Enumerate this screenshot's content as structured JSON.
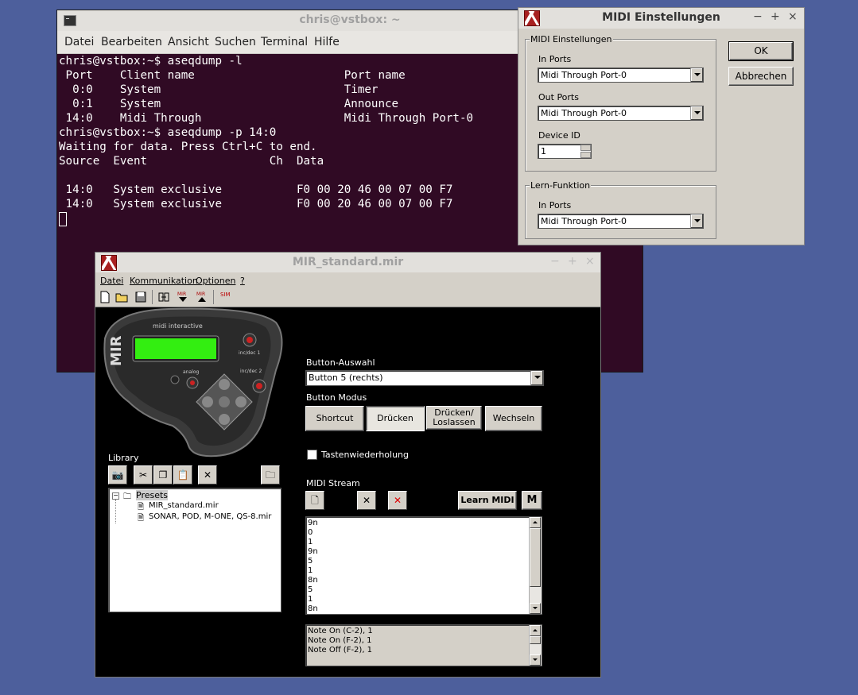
{
  "terminal": {
    "title": "chris@vstbox: ~",
    "menu": [
      "Datei",
      "Bearbeiten",
      "Ansicht",
      "Suchen",
      "Terminal",
      "Hilfe"
    ],
    "lines": [
      "chris@vstbox:~$ aseqdump -l",
      " Port    Client name                      Port name",
      "  0:0    System                           Timer",
      "  0:1    System                           Announce",
      " 14:0    Midi Through                     Midi Through Port-0",
      "chris@vstbox:~$ aseqdump -p 14:0",
      "Waiting for data. Press Ctrl+C to end.",
      "Source  Event                  Ch  Data",
      "",
      " 14:0   System exclusive           F0 00 20 46 00 07 00 F7",
      " 14:0   System exclusive           F0 00 20 46 00 07 00 F7"
    ]
  },
  "midi_dialog": {
    "title": "MIDI Einstellungen",
    "group1_label": "MIDI Einstellungen",
    "in_ports_label": "In Ports",
    "in_ports_value": "Midi Through Port-0",
    "out_ports_label": "Out Ports",
    "out_ports_value": "Midi Through Port-0",
    "device_id_label": "Device ID",
    "device_id_value": "1",
    "group2_label": "Lern-Funktion",
    "learn_in_ports_label": "In Ports",
    "learn_in_ports_value": "Midi Through Port-0",
    "ok_label": "OK",
    "cancel_label": "Abbrechen"
  },
  "mir": {
    "title": "MIR_standard.mir",
    "menu": [
      "Datei",
      "Kommunikation",
      "Optionen",
      "?"
    ],
    "device": {
      "brand": "midi interactive",
      "model": "MIR",
      "labels": [
        "inc/dec 1",
        "analog",
        "inc/dec 2"
      ],
      "display_color": "#33ee11"
    },
    "library_label": "Library",
    "tree_root": "Presets",
    "tree_items": [
      "MIR_standard.mir",
      "SONAR, POD, M-ONE, QS-8.mir"
    ],
    "button_select_label": "Button-Auswahl",
    "button_select_value": "Button 5 (rechts)",
    "button_mode_label": "Button Modus",
    "modes": [
      "Shortcut",
      "Drücken",
      "Drücken/ Loslassen",
      "Wechseln"
    ],
    "active_mode": "Drücken",
    "repeat_label": "Tastenwiederholung",
    "midi_stream_label": "MIDI Stream",
    "learn_midi_label": "Learn MIDI",
    "m_label": "M",
    "stream": [
      "9n",
      "0",
      "1",
      "9n",
      "5",
      "1",
      "8n",
      "5",
      "1",
      "8n"
    ],
    "notes": [
      "Note On (C-2), 1",
      "Note On (F-2), 1",
      "Note Off (F-2), 1"
    ],
    "sim_label": "SIM"
  }
}
